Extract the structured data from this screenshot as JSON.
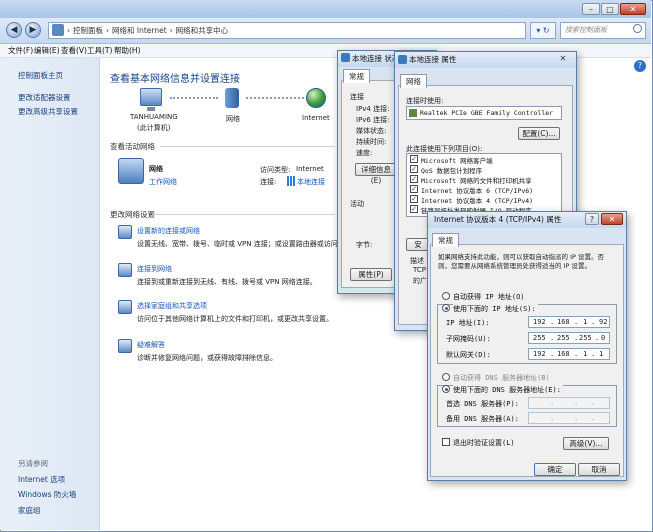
{
  "explorer": {
    "breadcrumb": [
      "控制面板",
      "网络和 Internet",
      "网络和共享中心"
    ],
    "search_placeholder": "搜索控制面板",
    "menu": [
      "文件(F)",
      "编辑(E)",
      "查看(V)",
      "工具(T)",
      "帮助(H)"
    ]
  },
  "leftpane": {
    "items": [
      "控制面板主页",
      "更改适配器设置",
      "更改高级共享设置"
    ],
    "see_also_title": "另请参阅",
    "see_also": [
      "Internet 选项",
      "Windows 防火墙",
      "家庭组"
    ]
  },
  "main": {
    "title": "查看基本网络信息并设置连接",
    "map": {
      "computer": "TANHUAMING",
      "computer_sub": "(此计算机)",
      "network": "网络",
      "internet": "Internet"
    },
    "active_title": "查看活动网络",
    "active": {
      "name": "网络",
      "type": "工作网络",
      "access_label": "访问类型:",
      "access_value": "Internet",
      "conn_label": "连接:",
      "conn_value": "本地连接"
    },
    "change_title": "更改网络设置",
    "tasks": [
      {
        "title": "设置新的连接或网络",
        "desc": "设置无线、宽带、拨号、临时或 VPN 连接；或设置路由器或访问点。"
      },
      {
        "title": "连接到网络",
        "desc": "连接到或重新连接到无线、有线、拨号或 VPN 网络连接。"
      },
      {
        "title": "选择家庭组和共享选项",
        "desc": "访问位于其他网络计算机上的文件和打印机，或更改共享设置。"
      },
      {
        "title": "疑难解答",
        "desc": "诊断并修复网络问题，或获得故障排除信息。"
      }
    ]
  },
  "status_dialog": {
    "title": "本地连接 状态",
    "tab": "常规",
    "labels": [
      "连接",
      "IPv4 连接:",
      "IPv6 连接:",
      "媒体状态:",
      "持续时间:",
      "速度:"
    ],
    "details_btn": "详细信息(E)",
    "activity": "活动",
    "bytes": "字节:",
    "props_btn": "属性(P)"
  },
  "props_dialog": {
    "title": "本地连接 属性",
    "tab": "网络",
    "connect_using": "连接时使用:",
    "adapter": "Realtek PCIe GBE Family Controller",
    "config_btn": "配置(C)...",
    "items_label": "此连接使用下列项目(O):",
    "items": [
      "Microsoft 网络客户端",
      "QoS 数据包计划程序",
      "Microsoft 网络的文件和打印机共享",
      "Internet 协议版本 6 (TCP/IPv6)",
      "Internet 协议版本 4 (TCP/IPv4)",
      "链路层拓扑发现映射器 I/O 驱动程序"
    ],
    "install_btn": "安",
    "desc_label": "描述",
    "desc_lines": [
      "TCP",
      "的广"
    ]
  },
  "ipv4_dialog": {
    "title": "Internet 协议版本 4 (TCP/IPv4) 属性",
    "tab": "常规",
    "intro": "如果网络支持此功能，则可以获取自动指派的 IP 设置。否则，您需要从网络系统管理员处获得适当的 IP 设置。",
    "auto_ip": "自动获得 IP 地址(O)",
    "manual_ip": "使用下面的 IP 地址(S):",
    "ip_label": "IP 地址(I):",
    "ip": [
      "192",
      "168",
      "1",
      "92"
    ],
    "mask_label": "子网掩码(U):",
    "mask": [
      "255",
      "255",
      "255",
      "0"
    ],
    "gw_label": "默认网关(D):",
    "gw": [
      "192",
      "168",
      "1",
      "1"
    ],
    "auto_dns": "自动获得 DNS 服务器地址(B)",
    "manual_dns": "使用下面的 DNS 服务器地址(E):",
    "dns1_label": "首选 DNS 服务器(P):",
    "dns2_label": "备用 DNS 服务器(A):",
    "validate": "退出时验证设置(L)",
    "advanced_btn": "高级(V)...",
    "ok_btn": "确定",
    "cancel_btn": "取消"
  }
}
